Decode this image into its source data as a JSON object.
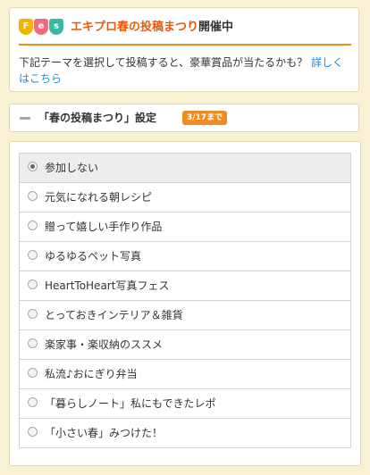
{
  "notice": {
    "logo_letters": [
      "F",
      "e",
      "s"
    ],
    "event_name": "エキプロ春の投稿まつり",
    "status": "開催中",
    "body_text": "下記テーマを選択して投稿すると、豪華賞品が当たるかも？ ",
    "link_text": "詳しくはこちら"
  },
  "setting": {
    "title": "「春の投稿まつり」設定",
    "badge": "3/17まで"
  },
  "options": [
    {
      "label": "参加しない",
      "selected": true
    },
    {
      "label": "元気になれる朝レシピ",
      "selected": false
    },
    {
      "label": "贈って嬉しい手作り作品",
      "selected": false
    },
    {
      "label": "ゆるゆるペット写真",
      "selected": false
    },
    {
      "label": "HeartToHeart写真フェス",
      "selected": false
    },
    {
      "label": "とっておきインテリア＆雑貨",
      "selected": false
    },
    {
      "label": "楽家事・楽収納のススメ",
      "selected": false
    },
    {
      "label": "私流♪おにぎり弁当",
      "selected": false
    },
    {
      "label": "「暮らしノート」私にもできたレポ",
      "selected": false
    },
    {
      "label": "「小さい春」みつけた！",
      "selected": false
    }
  ],
  "colors": {
    "accent_orange": "#f08c1e",
    "event_red": "#e8590c",
    "link_blue": "#1f8ad9",
    "page_background": "#f8f1d4"
  }
}
